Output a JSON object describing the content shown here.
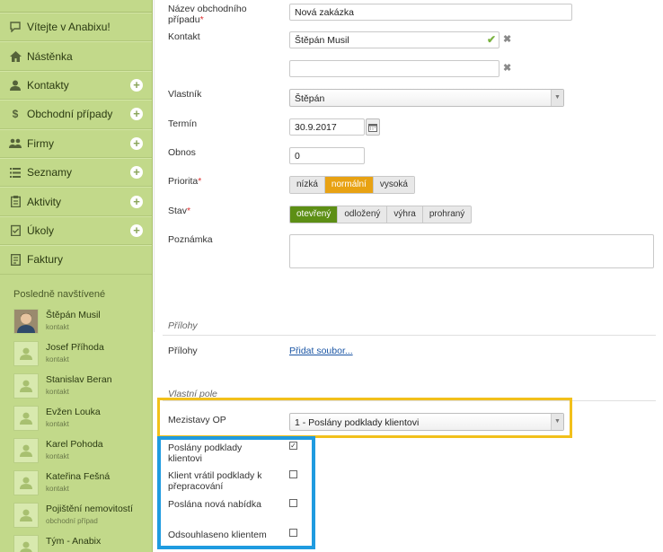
{
  "sidebar": {
    "items": [
      {
        "label": "Vítejte v Anabixu!",
        "icon": "speech-bubble-icon",
        "plus": false
      },
      {
        "label": "Nástěnka",
        "icon": "home-icon",
        "plus": false
      },
      {
        "label": "Kontakty",
        "icon": "person-icon",
        "plus": true
      },
      {
        "label": "Obchodní případy",
        "icon": "dollar-icon",
        "plus": true
      },
      {
        "label": "Firmy",
        "icon": "people-icon",
        "plus": true
      },
      {
        "label": "Seznamy",
        "icon": "list-icon",
        "plus": true
      },
      {
        "label": "Aktivity",
        "icon": "clipboard-icon",
        "plus": true
      },
      {
        "label": "Úkoly",
        "icon": "checklist-icon",
        "plus": true
      },
      {
        "label": "Faktury",
        "icon": "invoice-icon",
        "plus": false
      }
    ],
    "recent_title": "Posledně navštívené",
    "recent": [
      {
        "name": "Štěpán Musil",
        "type": "kontakt",
        "photo": true
      },
      {
        "name": "Josef Příhoda",
        "type": "kontakt",
        "photo": false
      },
      {
        "name": "Stanislav Beran",
        "type": "kontakt",
        "photo": false
      },
      {
        "name": "Evžen Louka",
        "type": "kontakt",
        "photo": false
      },
      {
        "name": "Karel Pohoda",
        "type": "kontakt",
        "photo": false
      },
      {
        "name": "Kateřina Fešná",
        "type": "kontakt",
        "photo": false
      },
      {
        "name": "Pojištění nemovitostí",
        "type": "obchodní případ",
        "photo": false
      },
      {
        "name": "Tým - Anabix",
        "type": "",
        "photo": false
      }
    ]
  },
  "form": {
    "nazev_label_1": "Název obchodního",
    "nazev_label_2": "případu",
    "nazev_value": "Nová zakázka",
    "kontakt_label": "Kontakt",
    "kontakt_value": "Štěpán Musil",
    "kontakt2_value": "",
    "vlastnik_label": "Vlastník",
    "vlastnik_value": "Štěpán",
    "termin_label": "Termín",
    "termin_value": "30.9.2017",
    "obnos_label": "Obnos",
    "obnos_value": "0",
    "priorita_label": "Priorita",
    "priorita_options": [
      "nízká",
      "normální",
      "vysoká"
    ],
    "priorita_selected": "normální",
    "stav_label": "Stav",
    "stav_options": [
      "otevřený",
      "odložený",
      "výhra",
      "prohraný"
    ],
    "stav_selected": "otevřený",
    "poznamka_label": "Poznámka",
    "poznamka_value": "",
    "prilohy_section": "Přílohy",
    "prilohy_label": "Přílohy",
    "prilohy_link": "Přidat soubor...",
    "vlastni_section": "Vlastní pole",
    "mezistavy_label": "Mezistavy OP",
    "mezistavy_value": "1 - Poslány podklady klientovi",
    "checks": [
      {
        "label_1": "Poslány podklady",
        "label_2": "klientovi",
        "checked": true
      },
      {
        "label_1": "Klient vrátil podklady k",
        "label_2": "přepracování",
        "checked": false
      },
      {
        "label_1": "Poslána nová nabídka",
        "label_2": "",
        "checked": false
      },
      {
        "label_1": "Odsouhlaseno klientem",
        "label_2": "",
        "checked": false
      }
    ]
  },
  "colors": {
    "sidebar_bg": "#c2d98a",
    "priority_selected": "#e8a213",
    "status_selected": "#5d8f15",
    "highlight_yellow": "#f2c01b",
    "highlight_blue": "#1f9be0"
  }
}
